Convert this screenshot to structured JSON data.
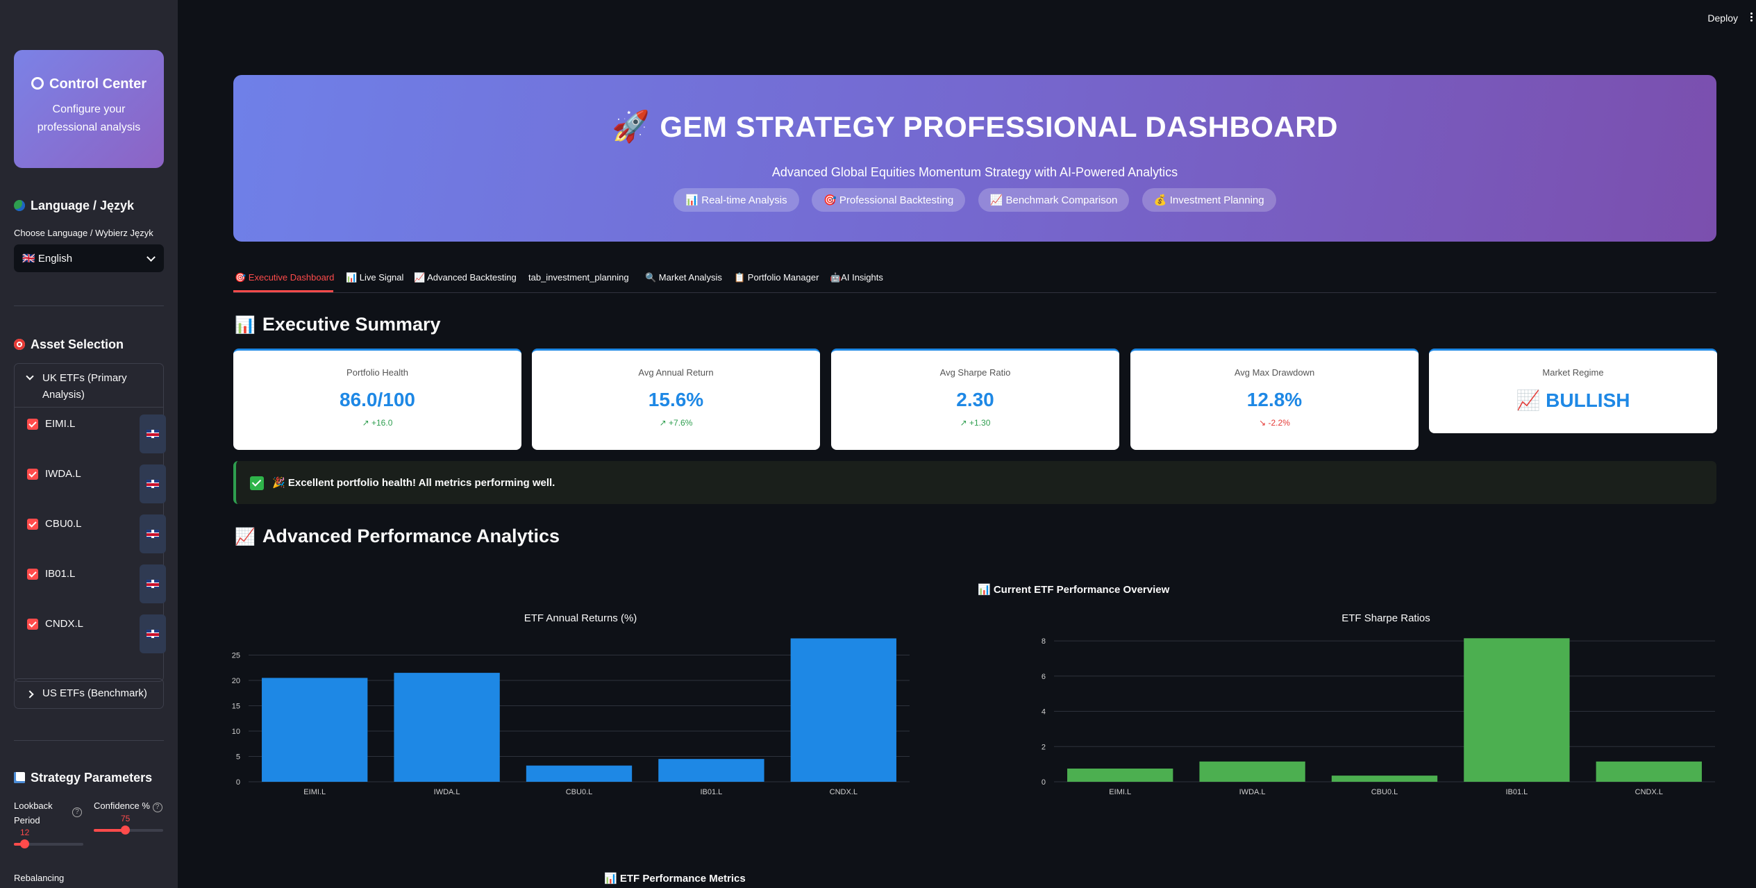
{
  "app": {
    "deploy_label": "Deploy"
  },
  "sidebar": {
    "control_center": {
      "title": "Control Center",
      "subtitle_line1": "Configure your",
      "subtitle_line2": "professional analysis"
    },
    "language": {
      "heading": "Language / Język",
      "label": "Choose Language / Wybierz Język",
      "selected": "🇬🇧 English"
    },
    "asset_selection": {
      "heading": "Asset Selection",
      "uk_expander": "UK ETFs (Primary Analysis)",
      "uk_etfs": [
        "EIMI.L",
        "IWDA.L",
        "CBU0.L",
        "IB01.L",
        "CNDX.L"
      ],
      "us_expander": "US ETFs (Benchmark)"
    },
    "strategy": {
      "heading": "Strategy Parameters",
      "lookback_label_1": "Lookback",
      "lookback_label_2": "Period",
      "lookback_value": "12",
      "lookback_fraction": 0.15,
      "confidence_label": "Confidence %",
      "confidence_value": "75",
      "confidence_fraction": 0.45,
      "rebalancing_label": "Rebalancing"
    }
  },
  "hero": {
    "title": "GEM STRATEGY PROFESSIONAL DASHBOARD",
    "subtitle": "Advanced Global Equities Momentum Strategy with AI-Powered Analytics",
    "pills": [
      "📊 Real-time Analysis",
      "🎯 Professional Backtesting",
      "📈 Benchmark Comparison",
      "💰 Investment Planning"
    ]
  },
  "tabs": [
    "🎯 Executive Dashboard",
    "📊 Live Signal",
    "📈 Advanced Backtesting",
    "tab_investment_planning",
    "🔍 Market Analysis",
    "📋 Portfolio Manager",
    "🤖AI Insights"
  ],
  "executive_summary": {
    "heading": "Executive Summary",
    "metrics": [
      {
        "label": "Portfolio Health",
        "value": "86.0/100",
        "delta": "↗ +16.0",
        "dir": "up"
      },
      {
        "label": "Avg Annual Return",
        "value": "15.6%",
        "delta": "↗ +7.6%",
        "dir": "up"
      },
      {
        "label": "Avg Sharpe Ratio",
        "value": "2.30",
        "delta": "↗ +1.30",
        "dir": "up"
      },
      {
        "label": "Avg Max Drawdown",
        "value": "12.8%",
        "delta": "↘ -2.2%",
        "dir": "down"
      },
      {
        "label": "Market Regime",
        "value": "📈 BULLISH",
        "delta": "",
        "dir": "none"
      }
    ],
    "alert": "🎉 Excellent portfolio health! All metrics performing well."
  },
  "analytics": {
    "heading": "Advanced Performance Analytics",
    "overview_title": "📊 Current ETF Performance Overview",
    "metrics_title": "📊 ETF Performance Metrics"
  },
  "chart_data": [
    {
      "type": "bar",
      "title": "ETF Annual Returns (%)",
      "categories": [
        "EIMI.L",
        "IWDA.L",
        "CBU0.L",
        "IB01.L",
        "CNDX.L"
      ],
      "values": [
        20.5,
        21.5,
        3.2,
        4.5,
        28.3
      ],
      "ylim": [
        0,
        28.5
      ],
      "yticks": [
        0,
        5,
        10,
        15,
        20,
        25
      ],
      "color": "#1e88e5",
      "grid": true
    },
    {
      "type": "bar",
      "title": "ETF Sharpe Ratios",
      "categories": [
        "EIMI.L",
        "IWDA.L",
        "CBU0.L",
        "IB01.L",
        "CNDX.L"
      ],
      "values": [
        0.75,
        1.15,
        0.35,
        8.15,
        1.15
      ],
      "ylim": [
        0,
        8.2
      ],
      "yticks": [
        0,
        2,
        4,
        6,
        8
      ],
      "color": "#4caf50",
      "grid": true
    }
  ]
}
